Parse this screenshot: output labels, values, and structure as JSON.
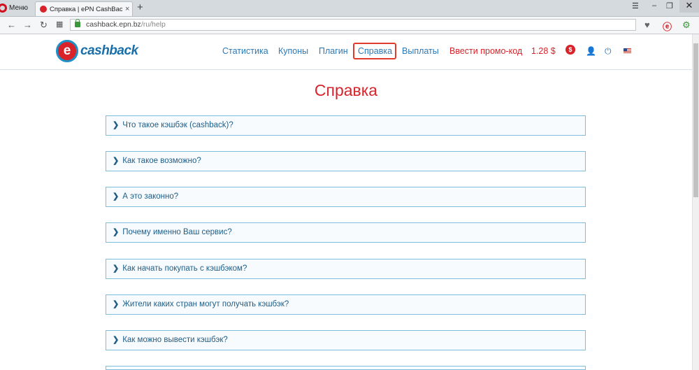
{
  "browser": {
    "menu_label": "Меню",
    "tab_title": "Справка | ePN CashBack - ",
    "tab_close": "×",
    "new_tab": "+",
    "url_host": "cashback.epn.bz",
    "url_path": "/ru/help"
  },
  "header": {
    "logo_text": "cashback",
    "logo_letter": "e",
    "nav": [
      {
        "label": "Статистика"
      },
      {
        "label": "Купоны"
      },
      {
        "label": "Плагин"
      },
      {
        "label": "Справка",
        "active": true
      },
      {
        "label": "Выплаты"
      }
    ],
    "promo_label": "Ввести промо-код",
    "balance": "1.28 $",
    "icons": [
      "dollar-badge-icon",
      "user-icon",
      "power-icon",
      "us-flag-icon"
    ]
  },
  "page": {
    "title": "Справка",
    "faq": [
      "Что такое кэшбэк (cashback)?",
      "Как такое возможно?",
      "А это законно?",
      "Почему именно Ваш сервис?",
      "Как начать покупать с кэшбэком?",
      "Жители каких стран могут получать кэшбэк?",
      "Как можно вывести кэшбэк?"
    ]
  },
  "colors": {
    "brand_red": "#d8232a",
    "brand_blue": "#1a6fa8",
    "link_blue": "#2a7ab9",
    "accordion_border": "#7dbedd"
  }
}
